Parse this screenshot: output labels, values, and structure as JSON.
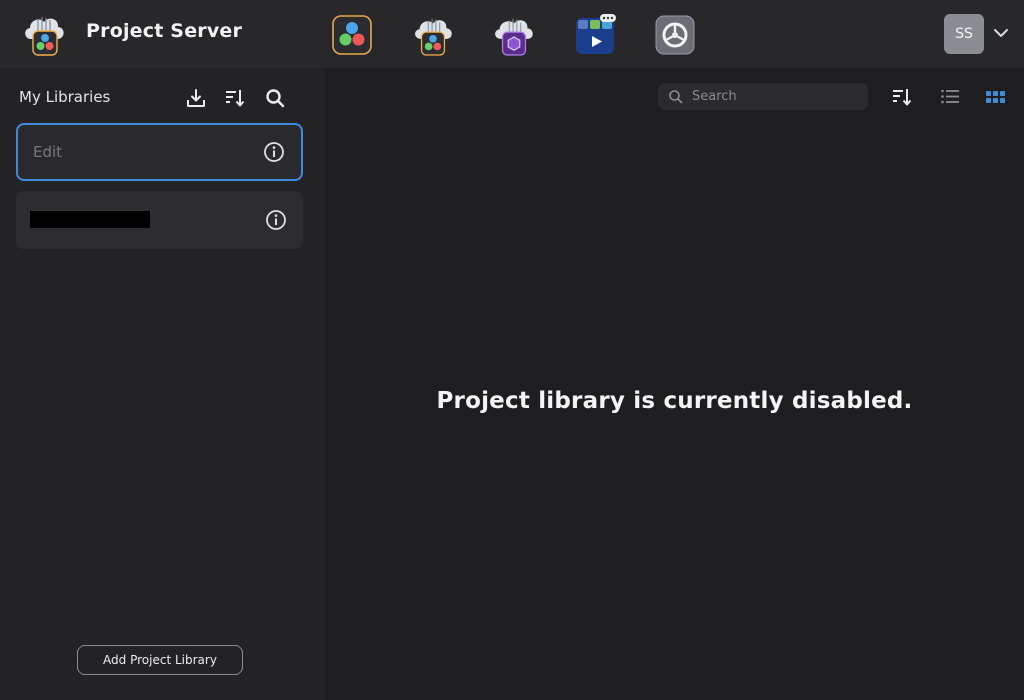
{
  "header": {
    "title": "Project Server",
    "logo_icon": "project-server-cloud-icon",
    "apps": [
      {
        "name": "davinci-resolve-icon"
      },
      {
        "name": "davinci-cloud-icon"
      },
      {
        "name": "cloud-store-icon"
      },
      {
        "name": "presentations-icon"
      },
      {
        "name": "settings-app-icon"
      }
    ],
    "user": {
      "initials": "SS"
    }
  },
  "sidebar": {
    "title": "My Libraries",
    "tools": [
      "import-icon",
      "sort-icon",
      "search-icon"
    ],
    "libraries": [
      {
        "label": "Edit",
        "selected": true
      },
      {
        "label": "",
        "redacted": true,
        "selected": false
      }
    ],
    "add_button_label": "Add Project Library"
  },
  "main": {
    "search": {
      "placeholder": "Search",
      "value": ""
    },
    "view_tools": [
      "sort-icon",
      "list-view-icon",
      "grid-view-icon"
    ],
    "active_view": "grid",
    "empty_message": "Project library is currently disabled."
  },
  "colors": {
    "accent": "#3d8bd9",
    "background": "#1e1e20",
    "sidebar": "#232326",
    "topbar": "#28282b"
  }
}
